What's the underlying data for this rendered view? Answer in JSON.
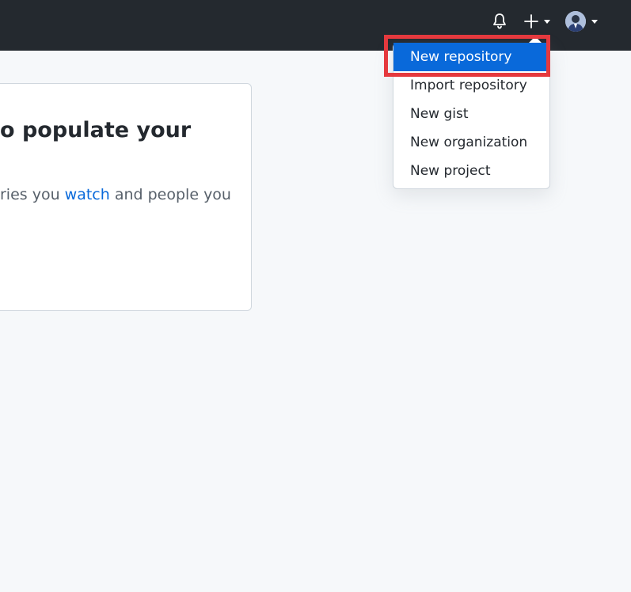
{
  "header": {
    "icons": {
      "notifications": "bell-icon",
      "create": "plus-icon",
      "avatar_caret": "chevron-down-icon"
    },
    "background": "#24292f"
  },
  "card": {
    "title": "o populate your",
    "text_before": "ries you ",
    "link_text": "watch",
    "text_after": " and people you"
  },
  "create_menu": {
    "items": [
      {
        "label": "New repository",
        "active": true
      },
      {
        "label": "Import repository",
        "active": false
      },
      {
        "label": "New gist",
        "active": false
      },
      {
        "label": "New organization",
        "active": false
      },
      {
        "label": "New project",
        "active": false
      }
    ],
    "active_color": "#0969da"
  },
  "annotation": {
    "highlight_color": "#e5393e"
  }
}
